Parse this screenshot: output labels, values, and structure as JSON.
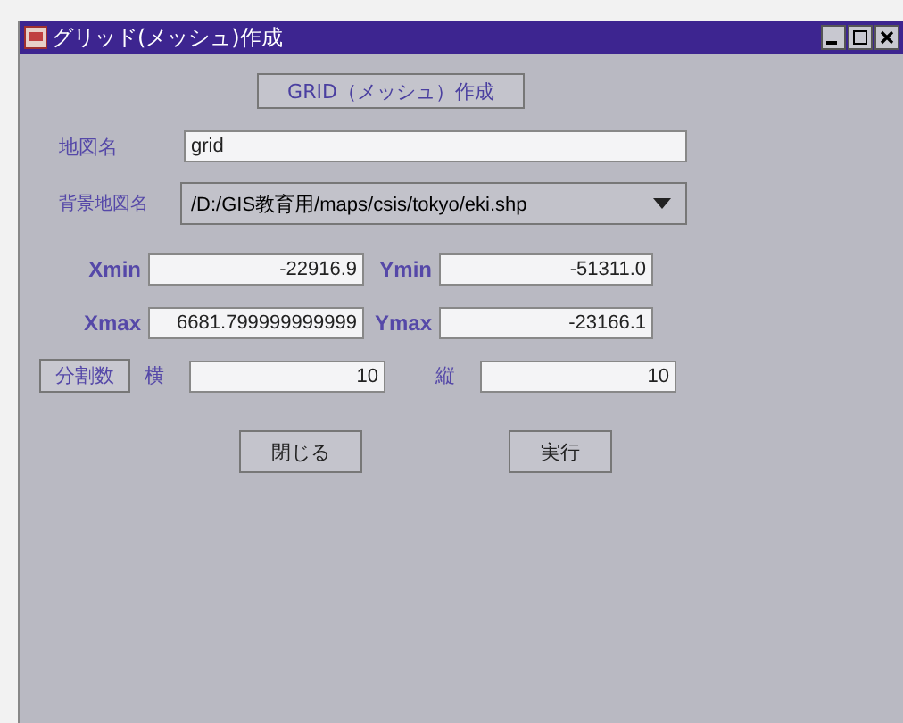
{
  "window": {
    "title": "グリッド(メッシュ)作成"
  },
  "heading": "GRID（メッシュ）作成",
  "map_name": {
    "label": "地図名",
    "value": "grid"
  },
  "background_map": {
    "label": "背景地図名",
    "value": "/D:/GIS教育用/maps/csis/tokyo/eki.shp"
  },
  "extent": [
    {
      "label": "Xmin",
      "value": "-22916.9"
    },
    {
      "label": "Ymin",
      "value": "-51311.0"
    },
    {
      "label": "Xmax",
      "value": "6681.799999999999"
    },
    {
      "label": "Ymax",
      "value": "-23166.1"
    }
  ],
  "divisions": {
    "button": "分割数",
    "fields": [
      {
        "label": "横",
        "value": "10"
      },
      {
        "label": "縦",
        "value": "10"
      }
    ]
  },
  "buttons": [
    "閉じる",
    "実行"
  ]
}
